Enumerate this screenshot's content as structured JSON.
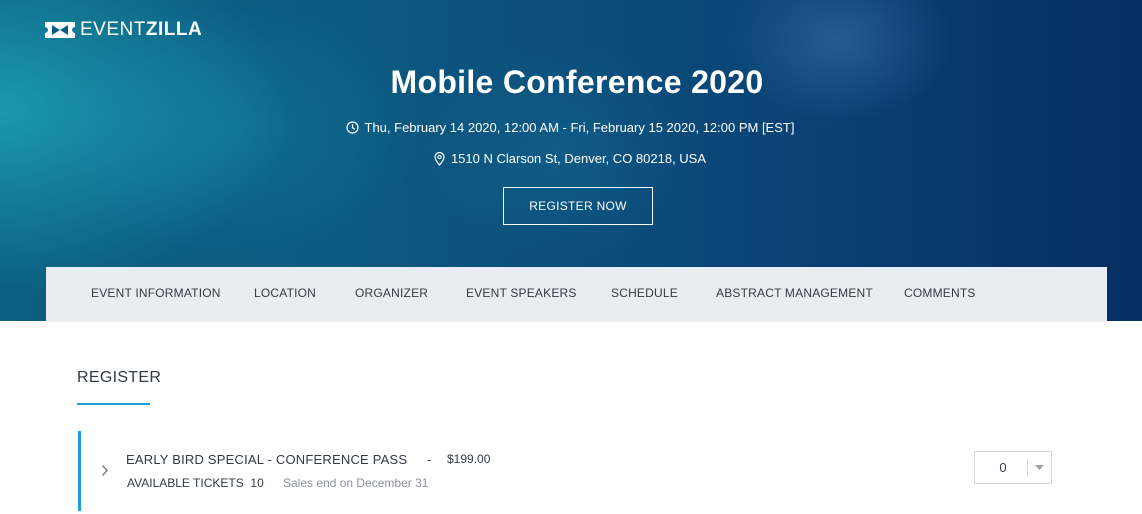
{
  "brand": {
    "logo_light": "EVENT",
    "logo_bold": "ZILLA",
    "icon": "ticket-logo-icon"
  },
  "event": {
    "title": "Mobile Conference 2020",
    "date_range": "Thu, February 14 2020, 12:00 AM - Fri, February 15 2020, 12:00 PM [EST]",
    "address": "1510 N Clarson St, Denver, CO 80218, USA",
    "date_icon": "clock-icon",
    "address_icon": "map-pin-icon"
  },
  "hero": {
    "register_label": "REGISTER NOW"
  },
  "nav": {
    "items": [
      {
        "label": "EVENT INFORMATION"
      },
      {
        "label": "LOCATION"
      },
      {
        "label": "ORGANIZER"
      },
      {
        "label": "EVENT SPEAKERS"
      },
      {
        "label": "SCHEDULE"
      },
      {
        "label": "ABSTRACT MANAGEMENT"
      },
      {
        "label": "COMMENTS"
      }
    ]
  },
  "register_section": {
    "title": "REGISTER",
    "tickets": [
      {
        "name": "EARLY BIRD SPECIAL - CONFERENCE PASS",
        "separator": "-",
        "price": "$199.00",
        "available_label": "AVAILABLE TICKETS",
        "available_count": "10",
        "sales_end": "Sales end on December 31",
        "quantity": "0"
      }
    ]
  },
  "colors": {
    "accent": "#1aa0d8",
    "hero_dark": "#072e63",
    "hero_teal": "#0b5f80",
    "nav_bg": "#e8edf2",
    "text": "#333a44",
    "muted": "#8b9099"
  }
}
